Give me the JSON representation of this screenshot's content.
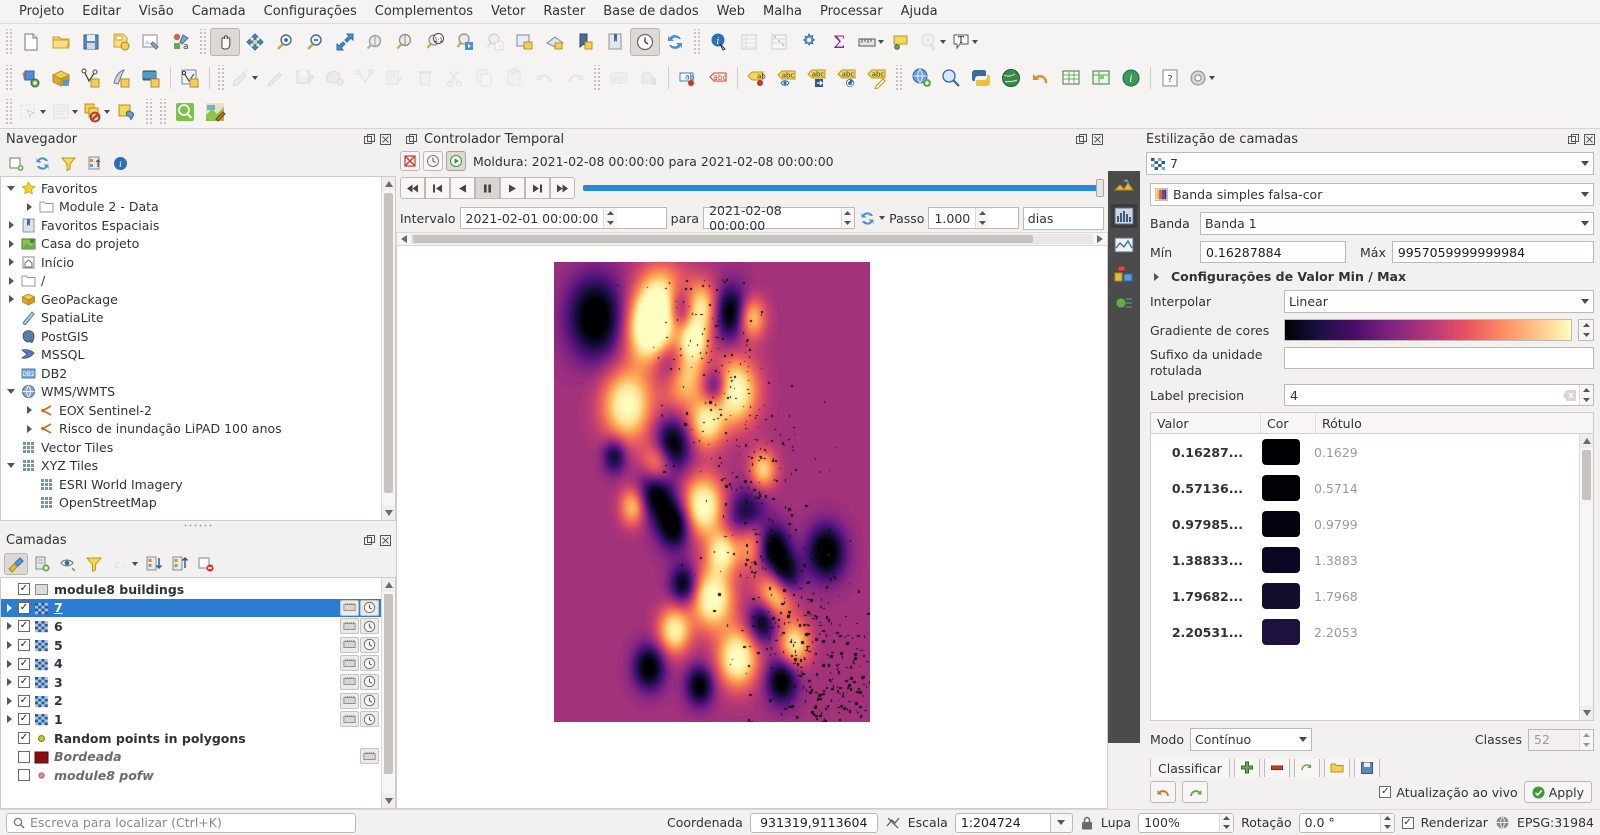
{
  "menubar": [
    {
      "label": "Projeto",
      "mnemonic": "P"
    },
    {
      "label": "Editar",
      "mnemonic": "E"
    },
    {
      "label": "Visão",
      "mnemonic": "V"
    },
    {
      "label": "Camada",
      "mnemonic": "C"
    },
    {
      "label": "Configurações",
      "mnemonic": "C"
    },
    {
      "label": "Complementos",
      "mnemonic": "C"
    },
    {
      "label": "Vetor",
      "mnemonic": "o"
    },
    {
      "label": "Raster",
      "mnemonic": "R"
    },
    {
      "label": "Base de dados",
      "mnemonic": "B"
    },
    {
      "label": "Web",
      "mnemonic": "W"
    },
    {
      "label": "Malha",
      "mnemonic": "M"
    },
    {
      "label": "Processar",
      "mnemonic": "c"
    },
    {
      "label": "Ajuda",
      "mnemonic": "A"
    }
  ],
  "navigator": {
    "title": "Navegador",
    "toolbar": [
      "add-layer-icon",
      "refresh-icon",
      "filter-icon",
      "collapse-all-icon",
      "info-icon"
    ],
    "items": [
      {
        "label": "Favoritos",
        "icon": "star-icon",
        "depth": 0,
        "expander": "down"
      },
      {
        "label": "Module 2 - Data",
        "icon": "folder-icon",
        "depth": 1,
        "expander": "right"
      },
      {
        "label": "Favoritos Espaciais",
        "icon": "bookmark-icon",
        "depth": 0,
        "expander": "right"
      },
      {
        "label": "Casa do projeto",
        "icon": "project-home-icon",
        "depth": 0,
        "expander": "right"
      },
      {
        "label": "Início",
        "icon": "home-icon",
        "depth": 0,
        "expander": "right"
      },
      {
        "label": "/",
        "icon": "folder-icon",
        "depth": 0,
        "expander": "right"
      },
      {
        "label": "GeoPackage",
        "icon": "geopackage-icon",
        "depth": 0,
        "expander": "right"
      },
      {
        "label": "SpatiaLite",
        "icon": "spatialite-icon",
        "depth": 0,
        "expander": "none"
      },
      {
        "label": "PostGIS",
        "icon": "postgis-icon",
        "depth": 0,
        "expander": "none"
      },
      {
        "label": "MSSQL",
        "icon": "mssql-icon",
        "depth": 0,
        "expander": "none"
      },
      {
        "label": "DB2",
        "icon": "db2-icon",
        "depth": 0,
        "expander": "none"
      },
      {
        "label": "WMS/WMTS",
        "icon": "wms-icon",
        "depth": 0,
        "expander": "down"
      },
      {
        "label": "EOX Sentinel-2",
        "icon": "wms-connection-icon",
        "depth": 1,
        "expander": "right"
      },
      {
        "label": "Risco de inundação LiPAD 100 anos",
        "icon": "wms-connection-icon",
        "depth": 1,
        "expander": "right"
      },
      {
        "label": "Vector Tiles",
        "icon": "tiles-icon",
        "depth": 0,
        "expander": "none"
      },
      {
        "label": "XYZ Tiles",
        "icon": "tiles-icon",
        "depth": 0,
        "expander": "down"
      },
      {
        "label": "ESRI World Imagery",
        "icon": "tiles-icon",
        "depth": 1,
        "expander": "none"
      },
      {
        "label": "OpenStreetMap",
        "icon": "tiles-icon",
        "depth": 1,
        "expander": "none"
      }
    ]
  },
  "layers": {
    "title": "Camadas",
    "toolbar": [
      "open-style-manager-icon",
      "add-group-icon",
      "manage-visibility-icon",
      "filter-legend-icon",
      "expression-filter-icon",
      "expand-all-icon",
      "collapse-all-icon",
      "remove-layer-icon"
    ],
    "items": [
      {
        "name": "module8 buildings",
        "checked": true,
        "selected": false,
        "icon": "polygon-layer-icon",
        "expander": "none",
        "badges": [],
        "italic": false
      },
      {
        "name": "7",
        "checked": true,
        "selected": true,
        "icon": "raster-layer-icon",
        "expander": "right",
        "badges": [
          "raster-icon",
          "temporal-icon"
        ],
        "italic": false
      },
      {
        "name": "6",
        "checked": true,
        "selected": false,
        "icon": "raster-layer-icon",
        "expander": "right",
        "badges": [
          "raster-icon",
          "temporal-icon"
        ],
        "italic": false
      },
      {
        "name": "5",
        "checked": true,
        "selected": false,
        "icon": "raster-layer-icon",
        "expander": "right",
        "badges": [
          "raster-icon",
          "temporal-icon"
        ],
        "italic": false
      },
      {
        "name": "4",
        "checked": true,
        "selected": false,
        "icon": "raster-layer-icon",
        "expander": "right",
        "badges": [
          "raster-icon",
          "temporal-icon"
        ],
        "italic": false
      },
      {
        "name": "3",
        "checked": true,
        "selected": false,
        "icon": "raster-layer-icon",
        "expander": "right",
        "badges": [
          "raster-icon",
          "temporal-icon"
        ],
        "italic": false
      },
      {
        "name": "2",
        "checked": true,
        "selected": false,
        "icon": "raster-layer-icon",
        "expander": "right",
        "badges": [
          "raster-icon",
          "temporal-icon"
        ],
        "italic": false
      },
      {
        "name": "1",
        "checked": true,
        "selected": false,
        "icon": "raster-layer-icon",
        "expander": "right",
        "badges": [
          "raster-icon",
          "temporal-icon"
        ],
        "italic": false
      },
      {
        "name": "Random points in polygons",
        "checked": true,
        "selected": false,
        "icon": "point-layer-icon",
        "expander": "none",
        "badges": [],
        "italic": false
      },
      {
        "name": "Bordeada",
        "checked": false,
        "selected": false,
        "icon": "polygon-dark-red-icon",
        "expander": "none",
        "badges": [
          "raster-icon"
        ],
        "italic": true
      },
      {
        "name": "module8 pofw",
        "checked": false,
        "selected": false,
        "icon": "point-pink-icon",
        "expander": "none",
        "badges": [],
        "italic": true
      }
    ]
  },
  "temporal": {
    "title": "Controlador Temporal",
    "mode_buttons": [
      "navigation-off-icon",
      "fixed-range-icon",
      "animated-icon"
    ],
    "frame_label": "Moldura: 2021-02-08 00:00:00 para 2021-02-08 00:00:00",
    "nav_buttons": [
      "skip-to-start-icon",
      "step-back-fast-icon",
      "play-reverse-icon",
      "pause-icon",
      "play-icon",
      "step-forward-icon",
      "skip-to-end-icon"
    ],
    "range_label": "Intervalo",
    "range_start": "2021-02-01 00:00:00",
    "range_to_label": "para",
    "range_end": "2021-02-08 00:00:00",
    "refresh_icon": "refresh-icon",
    "step_label": "Passo",
    "step_value": "1.000",
    "step_unit": "dias"
  },
  "style_panel": {
    "title": "Estilização de camadas",
    "layer_name": "7",
    "tabs": [
      "symbology-icon",
      "histogram-icon",
      "transparency-icon",
      "pyramids-icon",
      "rendering-icon"
    ],
    "renderer": "Banda simples falsa-cor",
    "band_label": "Banda",
    "band_value": "Banda 1",
    "min_label": "Mín",
    "min_value": "0.16287884",
    "max_label": "Máx",
    "max_value": "9957059999999984",
    "minmax_section": "Configurações de Valor Min / Max",
    "interpolate_label": "Interpolar",
    "interpolate_value": "Linear",
    "ramp_label": "Gradiente de cores",
    "ramp_name": "magma",
    "suffix_label": "Sufixo da unidade rotulada",
    "suffix_value": "",
    "precision_label": "Label precision",
    "precision_value": "4",
    "table_headers": [
      "Valor",
      "Cor",
      "Rótulo"
    ],
    "table_rows": [
      {
        "value": "0.16287...",
        "color": "#000004",
        "label": "0.1629"
      },
      {
        "value": "0.57136...",
        "color": "#010107",
        "label": "0.5714"
      },
      {
        "value": "0.97985...",
        "color": "#05030f",
        "label": "0.9799"
      },
      {
        "value": "1.38833...",
        "color": "#0a0722",
        "label": "1.3883"
      },
      {
        "value": "1.79682...",
        "color": "#140d2c",
        "label": "1.7968"
      },
      {
        "value": "2.20531...",
        "color": "#1e1140",
        "label": "2.2053"
      }
    ],
    "mode_label": "Modo",
    "mode_value": "Contínuo",
    "classes_label": "Classes",
    "classes_value": "52",
    "classify_label": "Classificar",
    "classify_buttons": [
      "add-class-icon",
      "remove-class-icon",
      "sort-icon",
      "load-icon",
      "save-icon"
    ],
    "undo_buttons": [
      "undo-icon",
      "redo-icon"
    ],
    "live_update_label": "Atualização ao vivo",
    "live_update_checked": true,
    "apply_label": "Apply"
  },
  "statusbar": {
    "locator_placeholder": "Escreva para localizar (Ctrl+K)",
    "coord_label": "Coordenada",
    "coord_value": "931319,9113604",
    "scale_label": "Escala",
    "scale_value": "1:204724",
    "magnifier_label": "Lupa",
    "magnifier_value": "100%",
    "rotation_label": "Rotação",
    "rotation_value": "0.0 °",
    "render_label": "Renderizar",
    "render_checked": true,
    "crs_value": "EPSG:31984"
  },
  "colors": {
    "selection_blue": "#2b7dd1",
    "slider_blue": "#2889d8",
    "panel_bg": "#f2f1f0",
    "apply_green": "#3a9a3a"
  }
}
